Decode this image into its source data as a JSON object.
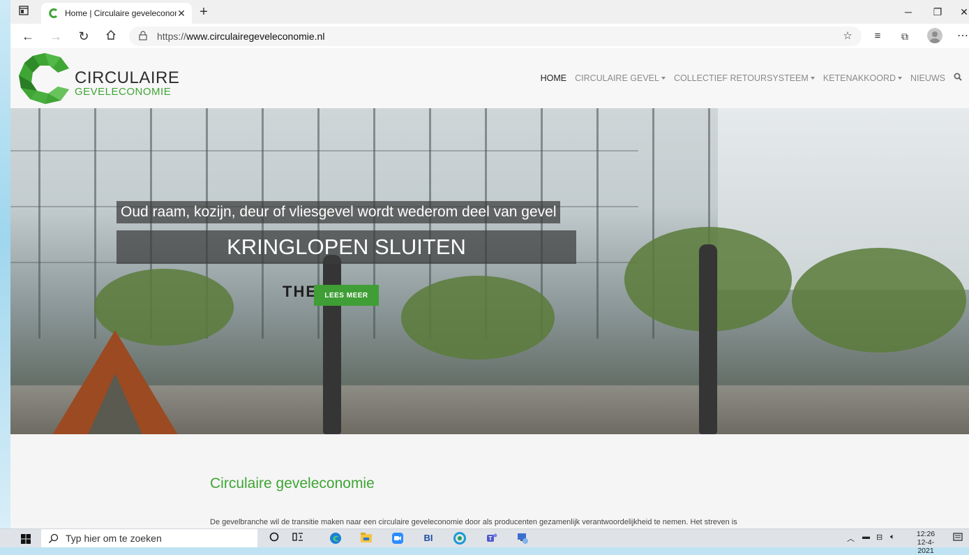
{
  "browser": {
    "tab_title": "Home | Circulaire geveleconomie",
    "url_prefix": "https://",
    "url_domain": "www.circulairegeveleconomie.nl"
  },
  "site": {
    "logo_line1": "CIRCULAIRE",
    "logo_line2": "GEVELECONOMIE",
    "brand_green": "#3fa535",
    "nav": [
      {
        "label": "HOME",
        "active": true,
        "dropdown": false
      },
      {
        "label": "CIRCULAIRE GEVEL",
        "active": false,
        "dropdown": true
      },
      {
        "label": "COLLECTIEF RETOURSYSTEEM",
        "active": false,
        "dropdown": true
      },
      {
        "label": "KETENAKKOORD",
        "active": false,
        "dropdown": true
      },
      {
        "label": "NIEUWS",
        "active": false,
        "dropdown": false
      }
    ]
  },
  "hero": {
    "caption": "Oud raam, kozijn, deur of vliesgevel wordt wederom deel van gevel",
    "headline": "KRINGLOPEN SLUITEN",
    "button": "LEES MEER",
    "sign": "THE"
  },
  "content": {
    "heading": "Circulaire geveleconomie",
    "intro": "De gevelbranche wil de transitie maken naar een circulaire geveleconomie door als producenten gezamenlijk verantwoordelijkheid te nemen. Het streven is"
  },
  "taskbar": {
    "search_placeholder": "Typ hier om te zoeken",
    "time": "12:26",
    "date": "12-4-2021"
  }
}
